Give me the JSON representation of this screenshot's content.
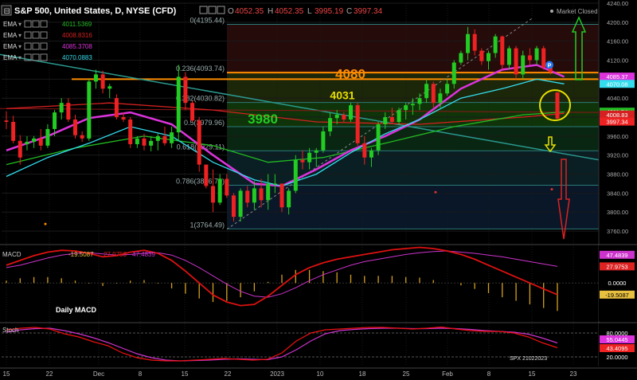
{
  "header": {
    "symbol": "S&P 500, United States, D, NYSE (CFD)",
    "ohlc": {
      "o": "4052.35",
      "h": "4052.35",
      "l": "3995.19",
      "c": "3997.34"
    },
    "market_status": "Market Closed"
  },
  "legend": [
    {
      "label": "EMA",
      "value": "4011.5369",
      "color": "#22bb22"
    },
    {
      "label": "EMA",
      "value": "4008.8316",
      "color": "#d42020"
    },
    {
      "label": "EMA",
      "value": "4085.3708",
      "color": "#dd33dd"
    },
    {
      "label": "EMA",
      "value": "4070.0883",
      "color": "#33ddee"
    }
  ],
  "colors": {
    "up": "#22cc22",
    "down": "#ee2222",
    "orange": "#ff8c00",
    "fib_line": "#2a8a8a"
  },
  "chart_data": {
    "type": "candlestick",
    "price_axis": {
      "min": 3740,
      "max": 4240,
      "ticks": [
        3760,
        3800,
        3840,
        3880,
        3920,
        3960,
        4000,
        4040,
        4080,
        4120,
        4160,
        4200,
        4240
      ]
    },
    "x_labels": [
      "15",
      "22",
      "Dec",
      "8",
      "15",
      "22",
      "2023",
      "10",
      "18",
      "25",
      "Feb",
      "8",
      "15",
      "23"
    ],
    "candles": [
      [
        3993,
        4012,
        3975,
        3990
      ],
      [
        3990,
        4003,
        3945,
        3950
      ],
      [
        3950,
        3962,
        3900,
        3915
      ],
      [
        3943,
        3960,
        3930,
        3948
      ],
      [
        3948,
        3960,
        3935,
        3955
      ],
      [
        3955,
        3975,
        3930,
        3940
      ],
      [
        3940,
        3985,
        3935,
        3975
      ],
      [
        3975,
        4015,
        3960,
        4010
      ],
      [
        4010,
        4040,
        3995,
        4030
      ],
      [
        4030,
        4040,
        3990,
        3995
      ],
      [
        3995,
        4005,
        3955,
        3962
      ],
      [
        3962,
        3970,
        3948,
        3955
      ],
      [
        3955,
        4080,
        3950,
        4075
      ],
      [
        4075,
        4100,
        4060,
        4090
      ],
      [
        4090,
        4098,
        4050,
        4060
      ],
      [
        4060,
        4070,
        4040,
        4065
      ],
      [
        4040,
        4048,
        3995,
        4000
      ],
      [
        4000,
        4010,
        3990,
        3995
      ],
      [
        3995,
        4000,
        3935,
        3943
      ],
      [
        3943,
        3960,
        3935,
        3955
      ],
      [
        3955,
        3965,
        3930,
        3940
      ],
      [
        3940,
        3960,
        3928,
        3950
      ],
      [
        3950,
        3965,
        3930,
        3960
      ],
      [
        3960,
        3980,
        3940,
        3945
      ],
      [
        3945,
        3980,
        3935,
        3968
      ],
      [
        3968,
        4110,
        3950,
        4085
      ],
      [
        4085,
        4095,
        4015,
        4030
      ],
      [
        4030,
        4035,
        3990,
        3993
      ],
      [
        3993,
        4000,
        3885,
        3900
      ],
      [
        3900,
        3900,
        3850,
        3855
      ],
      [
        3855,
        3890,
        3800,
        3820
      ],
      [
        3820,
        3880,
        3815,
        3870
      ],
      [
        3870,
        3880,
        3830,
        3835
      ],
      [
        3835,
        3840,
        3780,
        3790
      ],
      [
        3790,
        3850,
        3780,
        3845
      ],
      [
        3845,
        3855,
        3810,
        3820
      ],
      [
        3820,
        3865,
        3805,
        3850
      ],
      [
        3850,
        3870,
        3810,
        3825
      ],
      [
        3825,
        3880,
        3805,
        3860
      ],
      [
        3860,
        3880,
        3840,
        3860
      ],
      [
        3860,
        3860,
        3800,
        3810
      ],
      [
        3810,
        3850,
        3795,
        3845
      ],
      [
        3845,
        3920,
        3840,
        3910
      ],
      [
        3910,
        3930,
        3890,
        3905
      ],
      [
        3905,
        3935,
        3890,
        3925
      ],
      [
        3925,
        3935,
        3895,
        3930
      ],
      [
        3930,
        3980,
        3925,
        3970
      ],
      [
        3970,
        4010,
        3960,
        3998
      ],
      [
        3998,
        4015,
        3985,
        4005
      ],
      [
        4005,
        4010,
        3990,
        3995
      ],
      [
        3995,
        4030,
        3990,
        4025
      ],
      [
        4025,
        4030,
        3940,
        3945
      ],
      [
        3945,
        3960,
        3900,
        3915
      ],
      [
        3915,
        3935,
        3895,
        3930
      ],
      [
        3930,
        3990,
        3920,
        3985
      ],
      [
        3985,
        4010,
        3975,
        4000
      ],
      [
        4000,
        4020,
        3985,
        3990
      ],
      [
        3990,
        4020,
        3985,
        4015
      ],
      [
        4015,
        4030,
        3995,
        4025
      ],
      [
        4025,
        4040,
        4005,
        4028
      ],
      [
        4028,
        4050,
        4015,
        4040
      ],
      [
        4040,
        4080,
        4030,
        4070
      ],
      [
        4070,
        4075,
        4020,
        4030
      ],
      [
        4030,
        4060,
        4020,
        4050
      ],
      [
        4050,
        4080,
        4045,
        4070
      ],
      [
        4070,
        4120,
        4060,
        4115
      ],
      [
        4115,
        4140,
        4110,
        4135
      ],
      [
        4135,
        4190,
        4120,
        4175
      ],
      [
        4175,
        4185,
        4130,
        4140
      ],
      [
        4140,
        4145,
        4110,
        4118
      ],
      [
        4118,
        4140,
        4100,
        4135
      ],
      [
        4135,
        4175,
        4125,
        4170
      ],
      [
        4170,
        4172,
        4100,
        4110
      ],
      [
        4110,
        4150,
        4100,
        4145
      ],
      [
        4145,
        4150,
        4080,
        4090
      ],
      [
        4090,
        4140,
        4080,
        4130
      ],
      [
        4130,
        4145,
        4110,
        4120
      ],
      [
        4120,
        4150,
        4110,
        4145
      ],
      [
        4145,
        4150,
        4100,
        4105
      ],
      [
        4105,
        4110,
        4090,
        4095
      ],
      [
        4052,
        4052,
        3995,
        3997
      ]
    ],
    "ema_series": [
      {
        "name": "EMA",
        "color": "#d42020",
        "points": [
          [
            0,
            4018
          ],
          [
            15,
            4030
          ],
          [
            30,
            4015
          ],
          [
            45,
            3990
          ],
          [
            60,
            3985
          ],
          [
            75,
            4000
          ],
          [
            81,
            4008
          ]
        ]
      },
      {
        "name": "EMA",
        "color": "#22bb22",
        "points": [
          [
            0,
            3900
          ],
          [
            10,
            3935
          ],
          [
            20,
            3960
          ],
          [
            30,
            3940
          ],
          [
            38,
            3905
          ],
          [
            46,
            3915
          ],
          [
            55,
            3945
          ],
          [
            65,
            3980
          ],
          [
            75,
            4005
          ],
          [
            81,
            4011
          ]
        ]
      },
      {
        "name": "EMA",
        "color": "#dd33dd",
        "points": [
          [
            0,
            3930
          ],
          [
            6,
            3960
          ],
          [
            12,
            3998
          ],
          [
            18,
            4010
          ],
          [
            24,
            3985
          ],
          [
            30,
            3920
          ],
          [
            36,
            3860
          ],
          [
            40,
            3855
          ],
          [
            45,
            3890
          ],
          [
            50,
            3930
          ],
          [
            55,
            3960
          ],
          [
            60,
            3995
          ],
          [
            66,
            4060
          ],
          [
            72,
            4100
          ],
          [
            77,
            4110
          ],
          [
            81,
            4085
          ]
        ]
      },
      {
        "name": "EMA",
        "color": "#33ddee",
        "points": [
          [
            0,
            3875
          ],
          [
            6,
            3915
          ],
          [
            12,
            3945
          ],
          [
            18,
            3980
          ],
          [
            24,
            3960
          ],
          [
            30,
            3905
          ],
          [
            36,
            3868
          ],
          [
            40,
            3855
          ],
          [
            45,
            3880
          ],
          [
            50,
            3925
          ],
          [
            55,
            3965
          ],
          [
            60,
            3995
          ],
          [
            66,
            4040
          ],
          [
            72,
            4060
          ],
          [
            77,
            4080
          ],
          [
            81,
            4070
          ]
        ]
      }
    ],
    "fib_levels": [
      {
        "label": "0(4195.44)",
        "value": 4195.44
      },
      {
        "label": "0.236(4093.74)",
        "value": 4093.74
      },
      {
        "label": "0.382(4030.82)",
        "value": 4030.82
      },
      {
        "label": "0.5(3979.96)",
        "value": 3979.96
      },
      {
        "label": "0.618(3929.11)",
        "value": 3929.11
      },
      {
        "label": "0.786(3856.70)",
        "value": 3856.7
      },
      {
        "label": "1(3764.49)",
        "value": 3764.49
      }
    ],
    "annotations": [
      {
        "text": "4080",
        "value": 4080,
        "color": "#ff8c00"
      },
      {
        "text": "4031",
        "value": 4031,
        "color": "#e8e000"
      },
      {
        "text": "3980",
        "value": 3980,
        "color": "#22cc22"
      }
    ],
    "right_axis_badges": [
      {
        "text": "4085.37",
        "value": 4085.37,
        "color": "#dd33dd"
      },
      {
        "text": "4070.08",
        "value": 4070.08,
        "color": "#33ddee"
      },
      {
        "text": "4011.54",
        "value": 4011.54,
        "color": "#22bb22"
      },
      {
        "text": "4008.83",
        "value": 4008.83,
        "color": "#d42020"
      },
      {
        "text": "3997.34",
        "value": 3997.34,
        "color": "#ee2222"
      }
    ],
    "macd": {
      "title": "MACD",
      "values_text": [
        "-19.5087",
        "27.9753",
        "47.4839"
      ],
      "label": "Daily MACD",
      "axis_ticks": [
        "47.4839",
        "27.9753",
        "0.0000",
        "-19.5087"
      ],
      "macd_line": [
        30,
        38,
        46,
        52,
        55,
        54,
        50,
        44,
        46,
        52,
        55,
        50,
        38,
        20,
        0,
        -20,
        -32,
        -38,
        -36,
        -22,
        -4,
        14,
        26,
        34,
        40,
        44,
        48,
        52,
        56,
        58,
        60,
        58,
        54,
        48,
        40,
        30,
        20,
        10,
        0,
        -10,
        -19.5
      ],
      "signal_line": [
        26,
        30,
        36,
        42,
        47,
        50,
        51,
        49,
        47,
        48,
        50,
        51,
        47,
        38,
        26,
        12,
        -2,
        -14,
        -22,
        -24,
        -18,
        -8,
        4,
        14,
        22,
        30,
        36,
        40,
        44,
        48,
        51,
        53,
        54,
        52,
        50,
        47,
        44,
        40,
        36,
        32,
        28
      ],
      "histogram": [
        4,
        8,
        10,
        10,
        8,
        4,
        -1,
        -5,
        -1,
        4,
        5,
        -1,
        -9,
        -18,
        -26,
        -32,
        -30,
        -24,
        -14,
        2,
        14,
        22,
        22,
        20,
        18,
        14,
        12,
        12,
        12,
        10,
        9,
        5,
        0,
        -4,
        -10,
        -17,
        -24,
        -30,
        -36,
        -42,
        -47
      ]
    },
    "stoch": {
      "title": "Stoch",
      "axis_ticks": [
        "80.0000",
        "55.0445",
        "43.4095",
        "20.0000"
      ],
      "note": "SPX 21022023",
      "k_line": [
        88,
        92,
        94,
        90,
        78,
        70,
        58,
        48,
        30,
        18,
        12,
        10,
        10,
        12,
        14,
        16,
        14,
        12,
        14,
        30,
        60,
        80,
        88,
        90,
        92,
        94,
        94,
        92,
        90,
        92,
        95,
        90,
        86,
        84,
        84,
        80,
        70,
        55,
        43
      ],
      "d_line": [
        82,
        88,
        91,
        92,
        86,
        78,
        68,
        56,
        42,
        28,
        18,
        12,
        10,
        11,
        12,
        14,
        15,
        14,
        13,
        20,
        38,
        60,
        78,
        86,
        89,
        91,
        92,
        92,
        91,
        91,
        92,
        91,
        89,
        86,
        84,
        82,
        77,
        67,
        55
      ]
    }
  }
}
